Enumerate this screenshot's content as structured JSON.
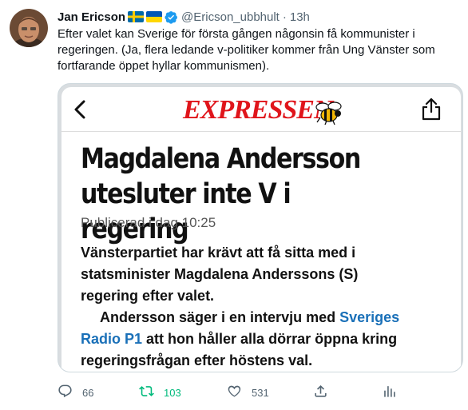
{
  "tweet": {
    "display_name": "Jan Ericson",
    "handle": "@Ericson_ubbhult",
    "separator": "·",
    "time": "13h",
    "text_line1": "Efter valet kan Sverige för första gången någonsin få kommunister i",
    "text_line2": "regeringen. (Ja, flera ledande v-politiker kommer från Ung Vänster som",
    "text_line3": "fortfarande öppet hyllar kommunismen)."
  },
  "card": {
    "logo_text": "EXPRESSEN",
    "headline_line1": "Magdalena Andersson",
    "headline_line2": "utesluter inte V i regering",
    "published": "Publicerad i dag 10:25",
    "lead_line1": "Vänsterpartiet har krävt att få sitta med i",
    "lead_line2": "statsminister Magdalena Anderssons (S)",
    "lead_line3": "regering efter valet.",
    "p2_part1": "Andersson säger i en intervju med ",
    "p2_link1": "Sveriges",
    "p2_link2": "Radio P1",
    "p2_part2": " att hon håller alla dörrar öppna kring",
    "p2_line3": "regeringsfrågan efter höstens val."
  },
  "actions": {
    "reply_count": "66",
    "retweet_count": "103",
    "like_count": "531"
  },
  "colors": {
    "accent": "#1d9bf0",
    "retweet": "#00ba7c",
    "expressen_red": "#e0151b",
    "link": "#1a70b8"
  },
  "icons": [
    "avatar",
    "sweden-flag-icon",
    "ukraine-flag-icon",
    "verified-badge-icon",
    "back-arrow-icon",
    "share-icon",
    "bee-logo-icon",
    "reply-icon",
    "retweet-icon",
    "like-icon",
    "share-tweet-icon",
    "analytics-icon"
  ]
}
